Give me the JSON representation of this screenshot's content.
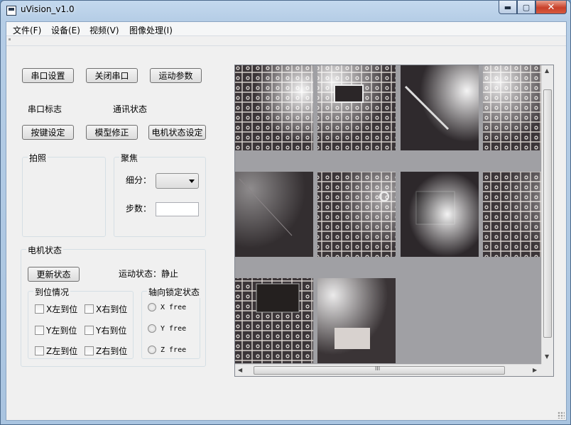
{
  "window": {
    "title": "uVision_v1.0"
  },
  "caption": {
    "minimize": "▬",
    "maximize": "▢",
    "close": "✕"
  },
  "menu": [
    "文件(F)",
    "设备(E)",
    "视频(V)",
    "图像处理(I)"
  ],
  "buttons": {
    "serial_settings": "串口设置",
    "close_serial": "关闭串口",
    "motion_params": "运动参数",
    "key_settings": "按键设定",
    "model_correct": "模型修正",
    "motor_state_set": "电机状态设定",
    "refresh_state": "更新状态"
  },
  "labels": {
    "serial_flag": "串口标志",
    "comm_status": "通讯状态",
    "motion_status": "运动状态：静止"
  },
  "groups": {
    "photo": "拍照",
    "focus": "聚焦",
    "motor_state": "电机状态",
    "position": "到位情况",
    "axis_lock": "轴向锁定状态"
  },
  "focus": {
    "subdiv_label": "细分：",
    "steps_label": "步数：",
    "steps_value": ""
  },
  "position_checks": [
    "X左到位",
    "X右到位",
    "Y左到位",
    "Y右到位",
    "Z左到位",
    "Z右到位"
  ],
  "axis_radios": [
    "X free",
    "Y free",
    "Z free"
  ],
  "scroll": {
    "up": "▲",
    "down": "▼",
    "left": "◀",
    "right": "▶",
    "hgrip": "III"
  },
  "colors": {
    "viewer_bg": "#a0a0a4",
    "window_frame": "#b5cde6",
    "client_bg": "#f0f0f0"
  }
}
